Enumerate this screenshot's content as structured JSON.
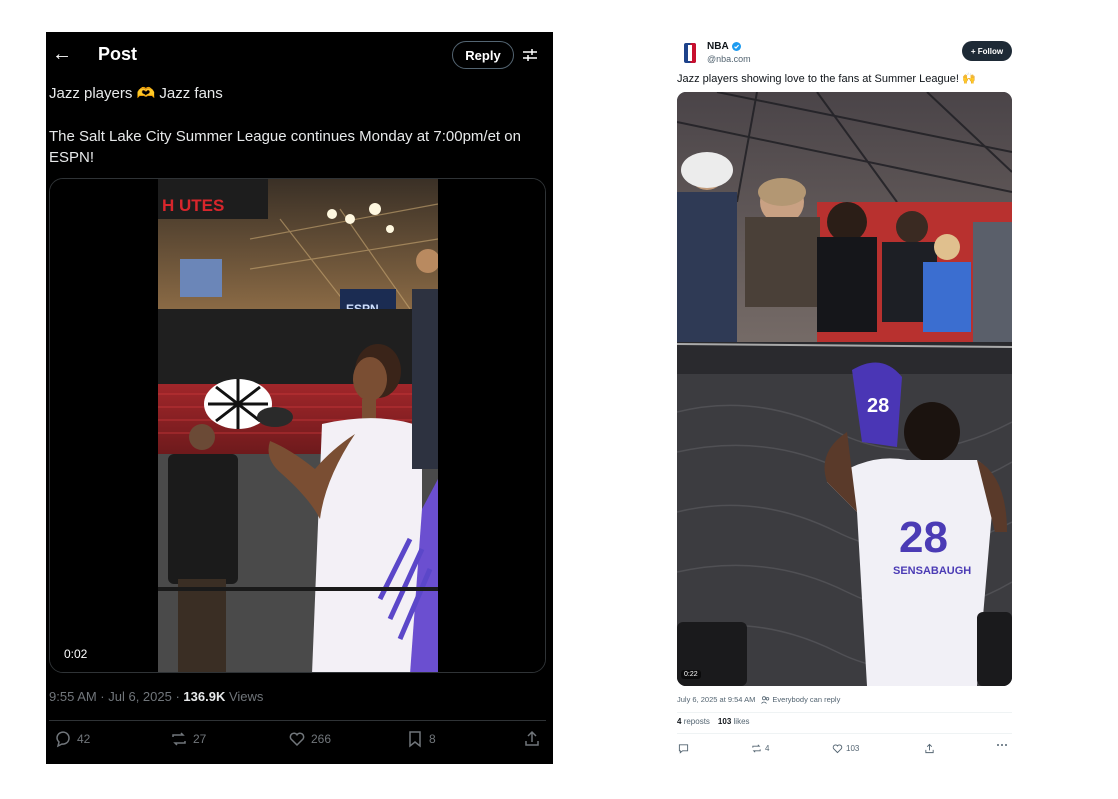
{
  "left": {
    "header": {
      "title": "Post",
      "reply_label": "Reply"
    },
    "tweet": {
      "line1_a": "Jazz players ",
      "line1_emoji": "🫶",
      "line1_b": " Jazz fans",
      "line2": "The Salt Lake City Summer League continues Monday at 7:00pm/et on ESPN!"
    },
    "video": {
      "duration": "0:02",
      "arena_sign": "H UTES",
      "scoreboard": "ESPN"
    },
    "meta": {
      "time_date": "9:55 AM · Jul 6, 2025 · ",
      "views_count": "136.9K",
      "views_label": " Views"
    },
    "actions": {
      "replies": "42",
      "reposts": "27",
      "likes": "266",
      "bookmarks": "8"
    }
  },
  "right": {
    "account": {
      "name": "NBA",
      "handle": "@nba.com"
    },
    "follow_label": "+ Follow",
    "text_a": "Jazz players showing love to the fans at Summer League! ",
    "text_emoji": "🙌",
    "video": {
      "duration": "0:22",
      "jersey_number": "28",
      "jersey_name": "SENSABAUGH"
    },
    "meta": {
      "date": "July 6, 2025 at 9:54 AM",
      "reply_setting": "Everybody can reply"
    },
    "stats": {
      "reposts_count": "4",
      "reposts_label": "reposts",
      "likes_count": "103",
      "likes_label": "likes"
    },
    "actions": {
      "reposts": "4",
      "likes": "103"
    }
  },
  "colors": {
    "x_bg": "#000000",
    "x_text": "#e7e9ea",
    "x_muted": "#71767b",
    "jazz_purple": "#5b47c9",
    "follow_bg": "#1e2a36"
  }
}
